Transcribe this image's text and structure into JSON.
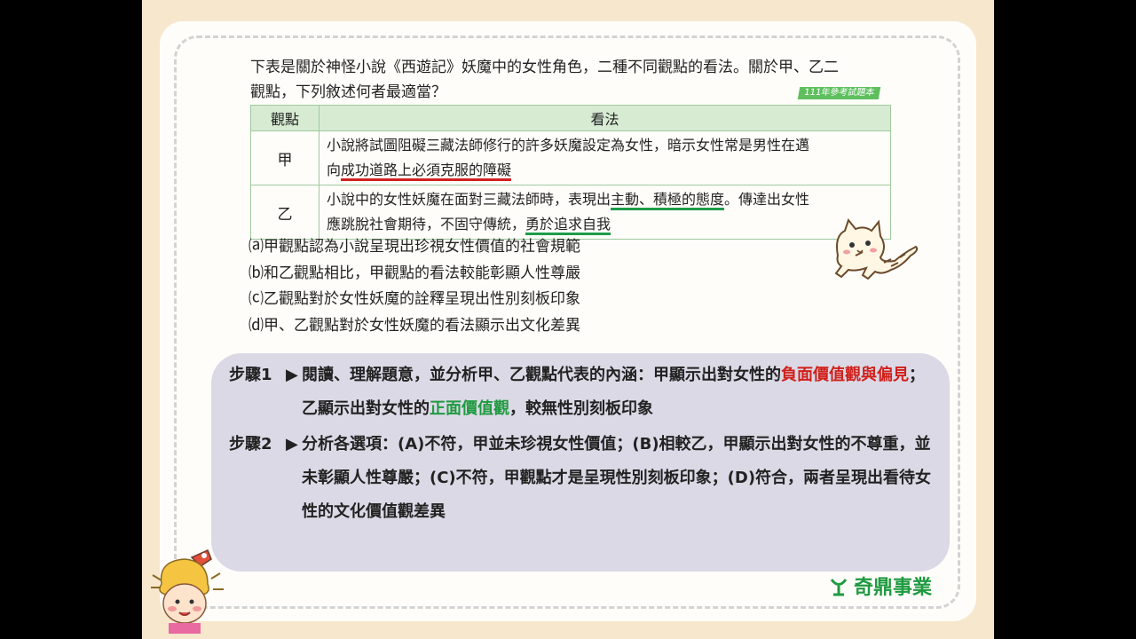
{
  "question": {
    "line1": "下表是關於神怪小說《西遊記》妖魔中的女性角色，二種不同觀點的看法。關於甲、乙二",
    "line2": "觀點，下列敘述何者最適當？",
    "source": "111年參考試題本"
  },
  "table": {
    "headers": [
      "觀點",
      "看法"
    ],
    "rows": [
      {
        "label": "甲",
        "text_a": "小說將試圖阻礙三藏法師修行的許多妖魔設定為女性，暗示女性常是男性在邁",
        "text_b": "向",
        "text_b_ul": "成功道路上必須克服的障礙"
      },
      {
        "label": "乙",
        "text_a": "小說中的女性妖魔在面對三藏法師時，表現出",
        "text_a_ul": "主動、積極的態度",
        "text_a_end": "。傳達出女性",
        "text_b": "應跳脫社會期待，不固守傳統，",
        "text_b_ul": "勇於追求自我"
      }
    ]
  },
  "options": [
    "⒜甲觀點認為小說呈現出珍視女性價值的社會規範",
    "⒝和乙觀點相比，甲觀點的看法較能彰顯人性尊嚴",
    "⒞乙觀點對於女性妖魔的詮釋呈現出性別刻板印象",
    "⒟甲、乙觀點對於女性妖魔的看法顯示出文化差異"
  ],
  "solution": {
    "step1": {
      "label": "步驟1",
      "arrow": "▶",
      "t1": "閱讀、理解題意，並分析甲、乙觀點代表的內涵：甲顯示出對女性的",
      "t1_red": "負面價值觀與偏見",
      "t2": "；乙顯示出對女性的",
      "t2_green": "正面價值觀",
      "t3": "，較無性別刻板印象"
    },
    "step2": {
      "label": "步驟2",
      "arrow": "▶",
      "text": "分析各選項：(A)不符，甲並未珍視女性價值；(B)相較乙，甲顯示出對女性的不尊重，並未彰顯人性尊嚴；(C)不符，甲觀點才是呈現性別刻板印象；(D)符合，兩者呈現出看待女性的文化價值觀差異"
    }
  },
  "logo": {
    "text": "奇鼎事業"
  },
  "colors": {
    "accent_green": "#1f9a40",
    "accent_red": "#d0201a",
    "panel": "#dcd9e6"
  },
  "icons": [
    "cat-illustration",
    "girl-illustration",
    "logo-icon"
  ]
}
